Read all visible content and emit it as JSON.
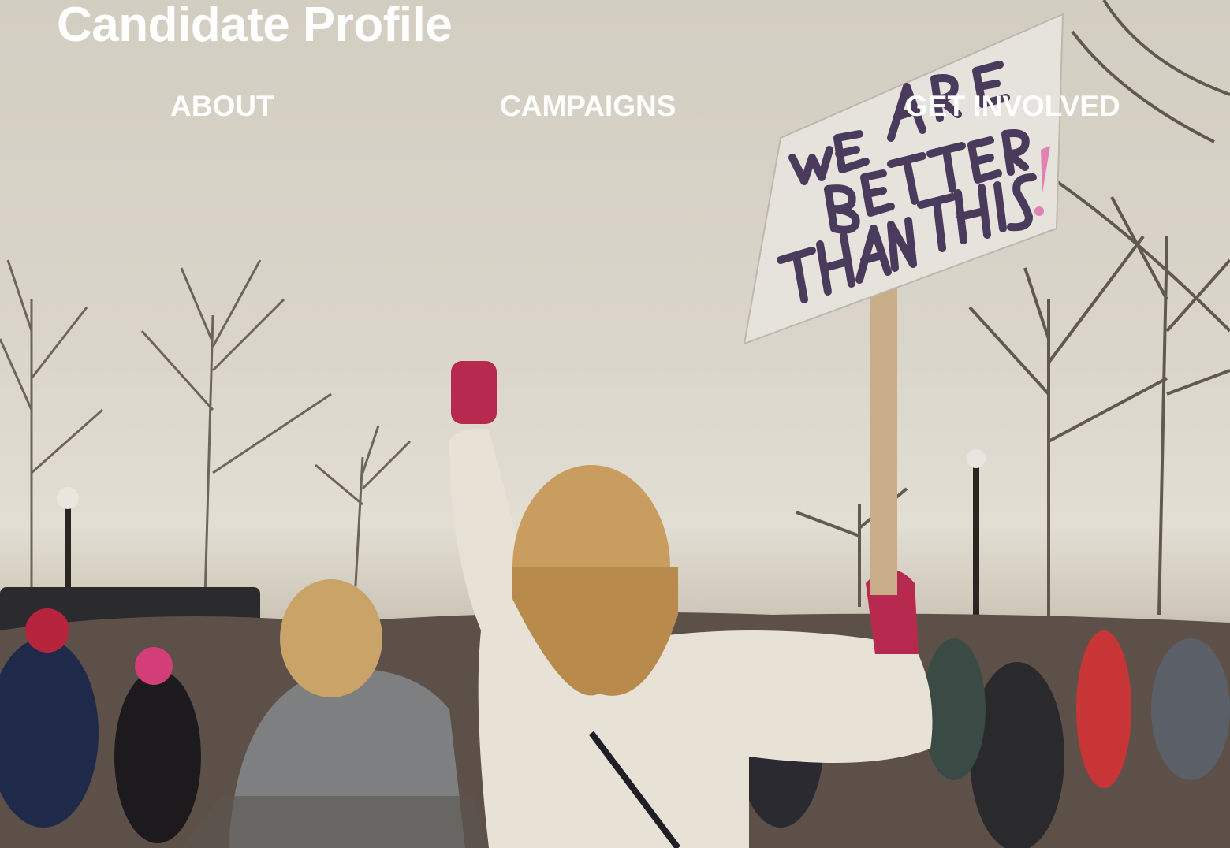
{
  "header": {
    "title": "Candidate Profile"
  },
  "nav": {
    "items": [
      {
        "label": "ABOUT"
      },
      {
        "label": "CAMPAIGNS"
      },
      {
        "label": "GET INVOLVED"
      }
    ]
  },
  "hero": {
    "image": "protest-march-photo",
    "sign_text": "WE ARE BETTER THAN THIS!"
  },
  "colors": {
    "text": "#ffffff",
    "sky": "#dad5ca"
  }
}
